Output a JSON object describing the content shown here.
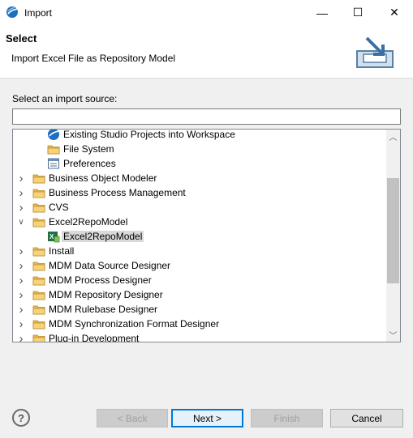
{
  "window": {
    "title": "Import",
    "minimize_glyph": "—",
    "maximize_glyph": "☐",
    "close_glyph": "✕"
  },
  "header": {
    "title": "Select",
    "description": "Import Excel File as Repository Model"
  },
  "source": {
    "label": "Select an import source:",
    "filter_value": "",
    "filter_placeholder": ""
  },
  "tree": {
    "items": [
      {
        "label": "Existing Studio Projects into Workspace",
        "icon": "studio-globe-icon",
        "expandable": false,
        "expanded": false,
        "selected": false
      },
      {
        "label": "File System",
        "icon": "folder-icon",
        "expandable": false,
        "expanded": false,
        "selected": false
      },
      {
        "label": "Preferences",
        "icon": "preferences-icon",
        "expandable": false,
        "expanded": false,
        "selected": false
      },
      {
        "label": "Business Object Modeler",
        "icon": "folder-icon",
        "expandable": true,
        "expanded": false,
        "selected": false
      },
      {
        "label": "Business Process Management",
        "icon": "folder-icon",
        "expandable": true,
        "expanded": false,
        "selected": false
      },
      {
        "label": "CVS",
        "icon": "folder-icon",
        "expandable": true,
        "expanded": false,
        "selected": false
      },
      {
        "label": "Excel2RepoModel",
        "icon": "folder-icon",
        "expandable": true,
        "expanded": true,
        "selected": false
      },
      {
        "label": "Excel2RepoModel",
        "icon": "excel-icon",
        "expandable": false,
        "expanded": false,
        "selected": true
      },
      {
        "label": "Install",
        "icon": "folder-icon",
        "expandable": true,
        "expanded": false,
        "selected": false
      },
      {
        "label": "MDM Data Source Designer",
        "icon": "folder-icon",
        "expandable": true,
        "expanded": false,
        "selected": false
      },
      {
        "label": "MDM Process Designer",
        "icon": "folder-icon",
        "expandable": true,
        "expanded": false,
        "selected": false
      },
      {
        "label": "MDM Repository Designer",
        "icon": "folder-icon",
        "expandable": true,
        "expanded": false,
        "selected": false
      },
      {
        "label": "MDM Rulebase Designer",
        "icon": "folder-icon",
        "expandable": true,
        "expanded": false,
        "selected": false
      },
      {
        "label": "MDM Synchronization Format Designer",
        "icon": "folder-icon",
        "expandable": true,
        "expanded": false,
        "selected": false
      },
      {
        "label": "Plug-in Development",
        "icon": "folder-icon",
        "expandable": true,
        "expanded": false,
        "selected": false
      }
    ]
  },
  "buttons": {
    "help_glyph": "?",
    "back": "< Back",
    "next": "Next >",
    "finish": "Finish",
    "cancel": "Cancel"
  },
  "colors": {
    "folder": "#e8b84a",
    "globe": "#1e6fc1",
    "excel": "#1f7244",
    "selection": "#d9d9d9",
    "default_button_border": "#0078d7"
  }
}
